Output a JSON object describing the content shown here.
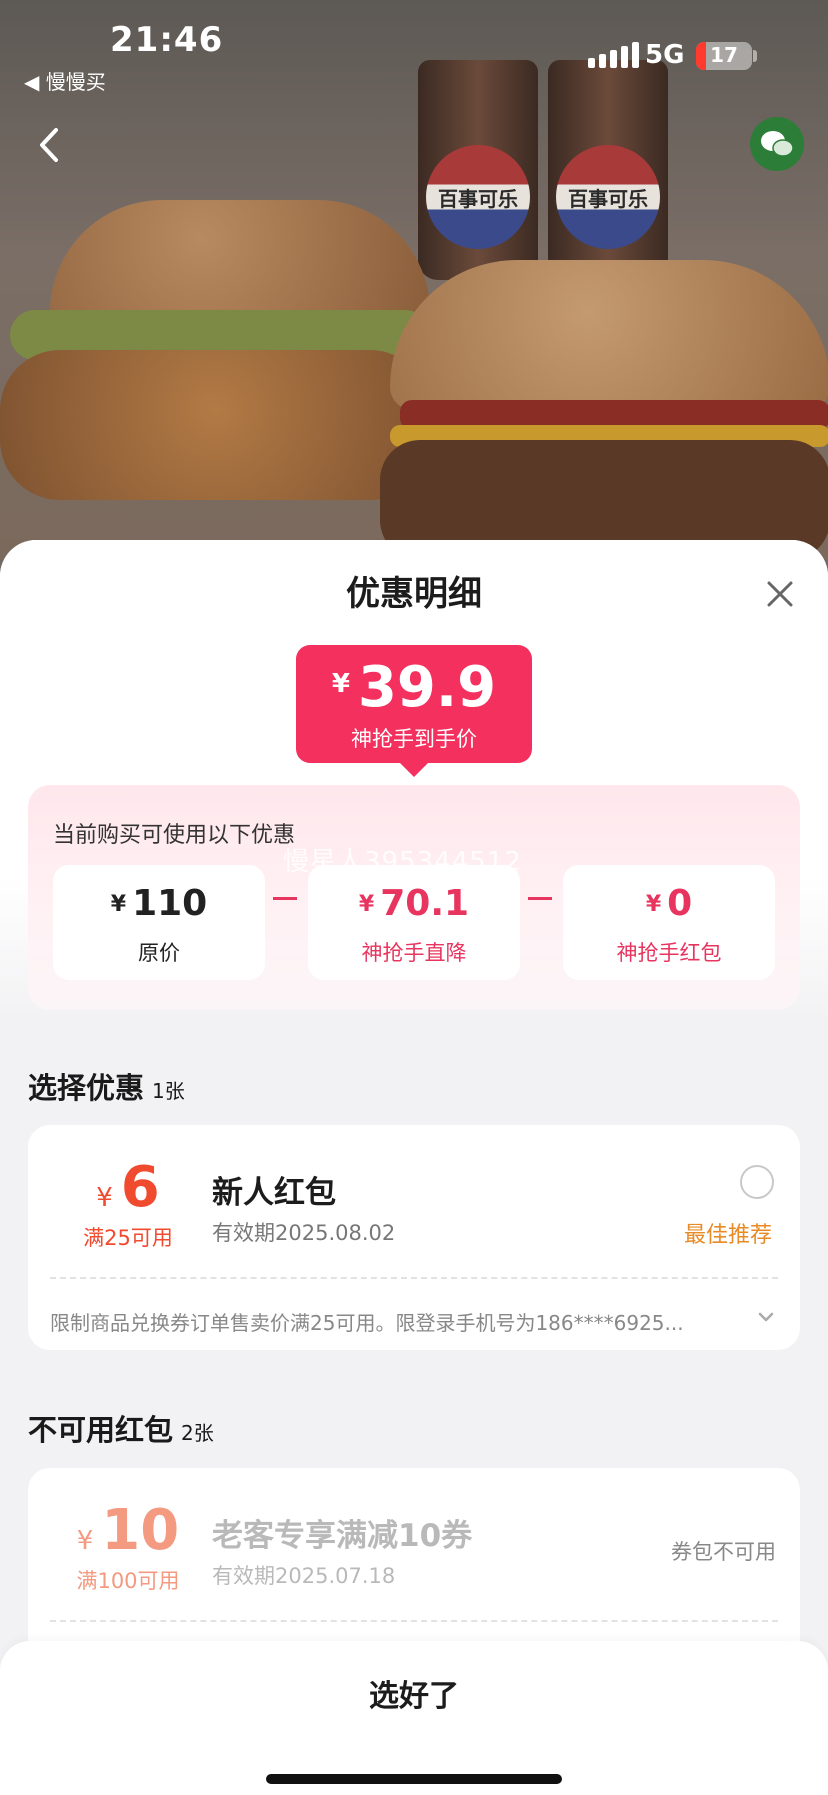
{
  "status_bar": {
    "time": "21:46",
    "back_app": "◀ 慢慢买",
    "network": "5G",
    "battery": "17",
    "battery_level_percent": 17
  },
  "hero": {
    "cup_logo_text": "百事可乐"
  },
  "sheet": {
    "title": "优惠明细",
    "price": {
      "currency": "¥",
      "value": "39.9",
      "desc": "神抢手到手价"
    },
    "discount": {
      "hint": "当前购买可使用以下优惠",
      "watermark": "慢星人395344512",
      "items": [
        {
          "currency": "¥",
          "value": "110",
          "label": "原价"
        },
        {
          "currency": "¥",
          "value": "70.1",
          "label": "神抢手直降"
        },
        {
          "currency": "¥",
          "value": "0",
          "label": "神抢手红包"
        }
      ]
    },
    "select_section": {
      "title": "选择优惠",
      "count": "1张"
    },
    "available_coupon": {
      "currency": "¥",
      "amount": "6",
      "condition": "满25可用",
      "name": "新人红包",
      "expiry": "有效期2025.08.02",
      "recommend": "最佳推荐",
      "rule": "限制商品兑换券订单售卖价满25可用。限登录手机号为186****6925..."
    },
    "unavailable_section": {
      "title": "不可用红包",
      "count": "2张"
    },
    "unavailable_coupon": {
      "currency": "¥",
      "amount": "10",
      "condition": "满100可用",
      "name": "老客专享满减10券",
      "expiry": "有效期2025.07.18",
      "status": "券包不可用"
    },
    "confirm_label": "选好了"
  },
  "colors": {
    "accent_pink": "#f4305e",
    "coupon_orange": "#f04a2f",
    "recommend_orange": "#e88a25"
  }
}
